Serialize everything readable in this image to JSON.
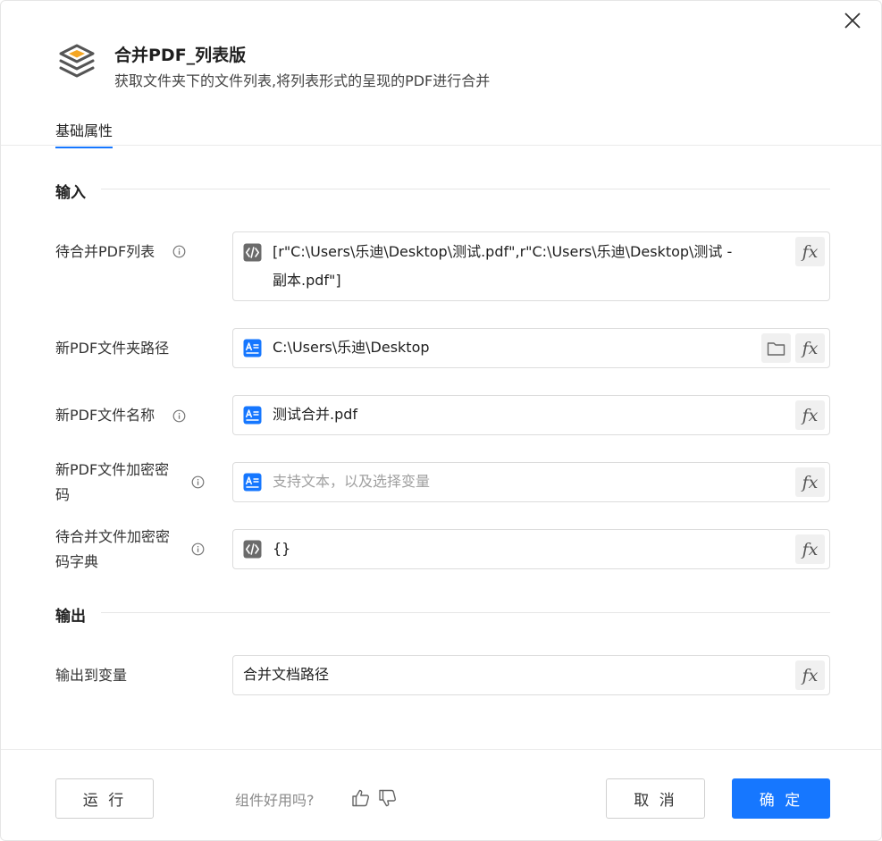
{
  "dialog": {
    "title": "合并PDF_列表版",
    "description": "获取文件夹下的文件列表,将列表形式的呈现的PDF进行合并",
    "close_icon": "close-icon",
    "header_icon": "layers-icon"
  },
  "tabs": [
    {
      "label": "基础属性",
      "active": true
    }
  ],
  "sections": {
    "input_title": "输入",
    "output_title": "输出"
  },
  "fields": {
    "pdf_list": {
      "label": "待合并PDF列表",
      "value_line1": "[r\"C:\\Users\\乐迪\\Desktop\\测试.pdf\",r\"C:\\Users\\乐迪\\Desktop\\测试 -",
      "value_line2": "副本.pdf\"]",
      "type_icon": "code-icon"
    },
    "new_folder": {
      "label": "新PDF文件夹路径",
      "value": "C:\\Users\\乐迪\\Desktop",
      "type_icon": "text-icon"
    },
    "new_name": {
      "label": "新PDF文件名称",
      "value": "测试合并.pdf",
      "type_icon": "text-icon"
    },
    "new_password": {
      "label_line1": "新PDF文件加密密",
      "label_line2": "码",
      "placeholder": "支持文本，以及选择变量",
      "type_icon": "text-icon"
    },
    "password_dict": {
      "label_line1": "待合并文件加密密",
      "label_line2": "码字典",
      "value": "{}",
      "type_icon": "code-icon"
    },
    "output_var": {
      "label": "输出到变量",
      "value": "合并文档路径"
    }
  },
  "fx_label": "fx",
  "footer": {
    "run_label": "运 行",
    "feedback_text": "组件好用吗?",
    "cancel_label": "取 消",
    "ok_label": "确 定"
  },
  "colors": {
    "accent": "#1677ff",
    "icon_orange": "#f5a623",
    "icon_gray": "#555555"
  }
}
